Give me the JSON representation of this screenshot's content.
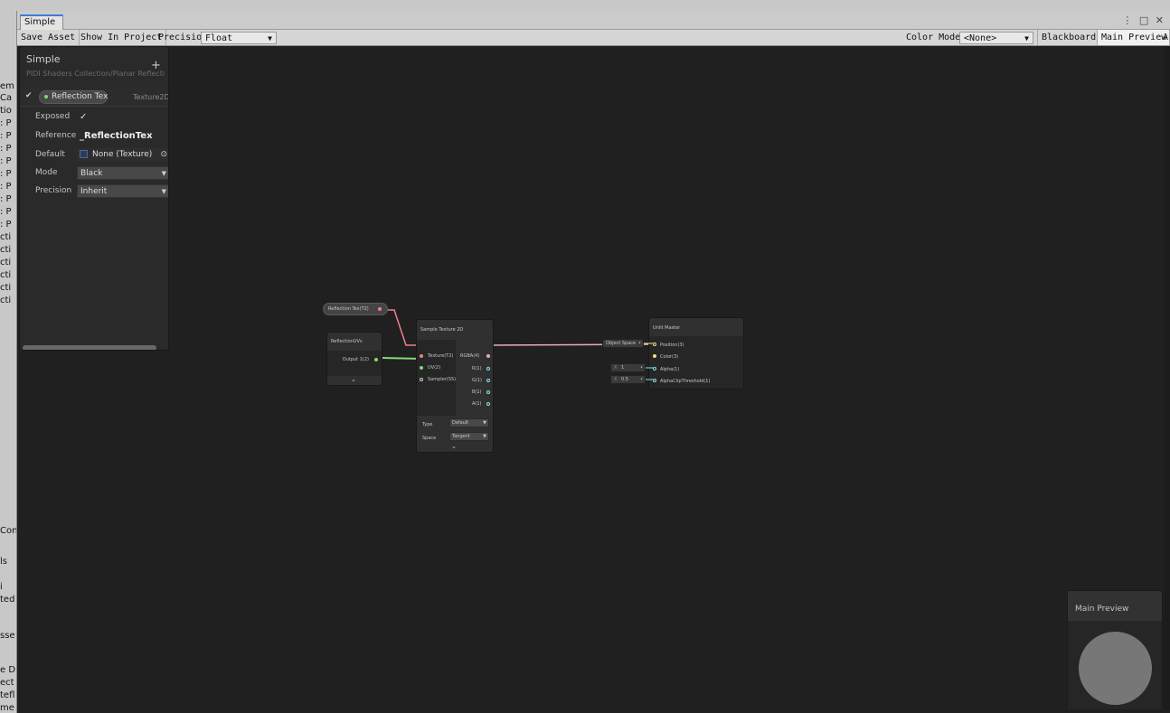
{
  "background": {
    "left_text": [
      "em",
      "Ca",
      "tio",
      ": P",
      ": P",
      ": P",
      ": P",
      ": P",
      ": P",
      ": P",
      ": P",
      ": P",
      "cti",
      "cti",
      "cti",
      "cti",
      "cti",
      "cti",
      "Con",
      "ls",
      "i",
      "ted",
      "sse",
      "e D",
      "ect",
      "tefl",
      "me"
    ],
    "right_text": "3/"
  },
  "window": {
    "tab_label": "Simple",
    "controls": "⋮ □ ✕"
  },
  "toolbar": {
    "save_asset": "Save Asset",
    "show_in_project": "Show In Project",
    "precision_label": "Precision",
    "precision_value": "Float",
    "color_mode_label": "Color Mode",
    "color_mode_value": "<None>",
    "blackboard": "Blackboard",
    "main_preview": "Main Preview",
    "overflow": "A"
  },
  "blackboard": {
    "title": "Simple",
    "subtitle": "PIDI Shaders Collection/Planar Reflecti",
    "add": "+",
    "property": {
      "name": "Reflection Tex",
      "type": "Texture2D",
      "exposed_label": "Exposed",
      "exposed_value": "✓",
      "reference_label": "Reference",
      "reference_value": "_ReflectionTex",
      "default_label": "Default",
      "default_value": "None (Texture)",
      "mode_label": "Mode",
      "mode_value": "Black",
      "precision_label": "Precision",
      "precision_value": "Inherit"
    }
  },
  "graph": {
    "prop_node": "Reflection Tex(T2)",
    "uv_node": {
      "title": "ReflectionUVs",
      "output": "Output 1(2)"
    },
    "sample_node": {
      "title": "Sample Texture 2D",
      "inputs": [
        "Texture(T2)",
        "UV(2)",
        "Sampler(SS)"
      ],
      "outputs": [
        "RGBA(4)",
        "R(1)",
        "G(1)",
        "B(1)",
        "A(1)"
      ],
      "type_label": "Type",
      "type_value": "Default",
      "space_label": "Space",
      "space_value": "Tangent"
    },
    "master_node": {
      "title": "Unlit Master",
      "inputs": [
        "Position(3)",
        "Color(3)",
        "Alpha(1)",
        "AlphaClipThreshold(1)"
      ],
      "position_field": "Object Space",
      "alpha_field": {
        "axis": "X",
        "value": "1"
      },
      "clip_field": {
        "axis": "X",
        "value": "0.5"
      }
    }
  },
  "preview": {
    "title": "Main Preview"
  },
  "colors": {
    "texture_port": "#f07f88",
    "vector2_port": "#7fdc6f",
    "color_port": "#f4e27a",
    "float_port": "#84e4e7",
    "rgba_wire": "#e8a8c8"
  }
}
